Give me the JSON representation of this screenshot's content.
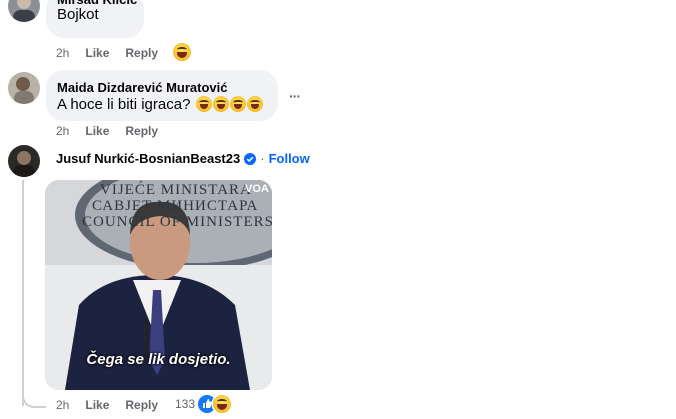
{
  "comments": [
    {
      "author": "Mirsad Klicic",
      "text": "Bojkot",
      "time": "2h",
      "like_label": "Like",
      "reply_label": "Reply"
    },
    {
      "author": "Maida Dizdarević Muratović",
      "text": "A hoce li biti igraca?",
      "time": "2h",
      "like_label": "Like",
      "reply_label": "Reply",
      "more_label": "···"
    },
    {
      "author": "Jusuf Nurkić-BosnianBeast23",
      "follow_label": "Follow",
      "separator": "·",
      "gif_caption": "Čega se lik dosjetio.",
      "gif_sign_lines": [
        "VIJEĆE MINISTARA",
        "САВЈЕТ МИНИСТАРА",
        "COUNCIL OF MINISTERS"
      ],
      "gif_logo": "VOA",
      "time": "2h",
      "like_label": "Like",
      "reply_label": "Reply",
      "reaction_count": "133"
    }
  ],
  "colors": {
    "bubble": "#f0f2f5",
    "meta_text": "#65676b",
    "link_blue": "#0866ff",
    "verified_blue": "#0866ff"
  }
}
